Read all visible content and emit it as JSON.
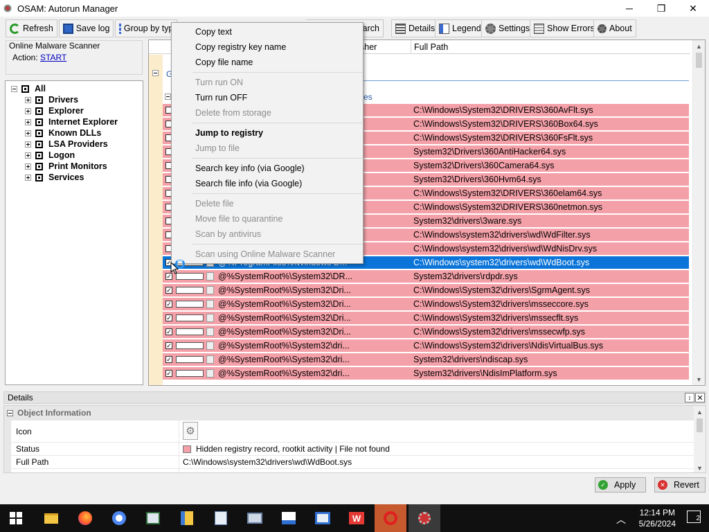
{
  "window": {
    "title": "OSAM: Autorun Manager",
    "minimize": "─",
    "maximize": "❐",
    "close": "✕"
  },
  "toolbar": {
    "refresh": "Refresh",
    "save_log": "Save log",
    "group_by": "Group by typ",
    "search": "earch",
    "details": "Details",
    "legend": "Legend",
    "settings": "Settings",
    "show_errors": "Show Errors",
    "about": "About"
  },
  "scanner": {
    "title": "Online Malware Scanner",
    "action_label": "Action:",
    "action_link": "START"
  },
  "tree": {
    "root": "All",
    "items": [
      "Drivers",
      "Explorer",
      "Internet Explorer",
      "Known DLLs",
      "LSA Providers",
      "Logon",
      "Print Monitors",
      "Services"
    ]
  },
  "list": {
    "columns": {
      "publisher": "sher",
      "full_path": "Full Path"
    },
    "group_label": "G",
    "subgroup_label": "es",
    "rows": [
      {
        "cmd": "",
        "path": "C:\\Windows\\System32\\DRIVERS\\360AvFlt.sys",
        "checked": false
      },
      {
        "cmd": "",
        "path": "C:\\Windows\\System32\\DRIVERS\\360Box64.sys",
        "checked": false
      },
      {
        "cmd": "",
        "path": "C:\\Windows\\System32\\DRIVERS\\360FsFlt.sys",
        "checked": false
      },
      {
        "cmd": "",
        "path": "System32\\Drivers\\360AntiHacker64.sys",
        "checked": false
      },
      {
        "cmd": "",
        "path": "System32\\Drivers\\360Camera64.sys",
        "checked": false
      },
      {
        "cmd": "",
        "path": "System32\\Drivers\\360Hvm64.sys",
        "checked": false
      },
      {
        "cmd": "",
        "path": "C:\\Windows\\System32\\DRIVERS\\360elam64.sys",
        "checked": false
      },
      {
        "cmd": "",
        "path": "C:\\Windows\\System32\\DRIVERS\\360netmon.sys",
        "checked": false
      },
      {
        "cmd": "",
        "path": "System32\\drivers\\3ware.sys",
        "checked": false
      },
      {
        "cmd": "",
        "path": "C:\\Windows\\system32\\drivers\\wd\\WdFilter.sys",
        "checked": false
      },
      {
        "cmd": "",
        "path": "C:\\Windows\\system32\\drivers\\wd\\WdNisDrv.sys",
        "checked": false
      },
      {
        "cmd": "@%ProgramFiles%\\Windows D...",
        "path": "C:\\Windows\\system32\\drivers\\wd\\WdBoot.sys",
        "checked": true,
        "selected": true
      },
      {
        "cmd": "@%SystemRoot%\\System32\\DR...",
        "path": "System32\\drivers\\rdpdr.sys",
        "checked": true
      },
      {
        "cmd": "@%SystemRoot%\\System32\\Dri...",
        "path": "C:\\Windows\\System32\\drivers\\SgrmAgent.sys",
        "checked": true
      },
      {
        "cmd": "@%SystemRoot%\\System32\\Dri...",
        "path": "C:\\Windows\\System32\\drivers\\msseccore.sys",
        "checked": true
      },
      {
        "cmd": "@%SystemRoot%\\System32\\Dri...",
        "path": "C:\\Windows\\System32\\drivers\\mssecflt.sys",
        "checked": true
      },
      {
        "cmd": "@%SystemRoot%\\System32\\Dri...",
        "path": "C:\\Windows\\System32\\drivers\\mssecwfp.sys",
        "checked": true
      },
      {
        "cmd": "@%SystemRoot%\\System32\\dri...",
        "path": "C:\\Windows\\System32\\drivers\\NdisVirtualBus.sys",
        "checked": true
      },
      {
        "cmd": "@%SystemRoot%\\System32\\dri...",
        "path": "System32\\drivers\\ndiscap.sys",
        "checked": true
      },
      {
        "cmd": "@%SystemRoot%\\System32\\dri...",
        "path": "System32\\drivers\\NdisImPlatform.sys",
        "checked": true
      }
    ]
  },
  "context_menu": [
    {
      "label": "Copy text",
      "enabled": true
    },
    {
      "label": "Copy registry key name",
      "enabled": true
    },
    {
      "label": "Copy file name",
      "enabled": true
    },
    {
      "label": "Turn run ON",
      "enabled": false
    },
    {
      "label": "Turn run OFF",
      "enabled": true
    },
    {
      "label": "Delete from storage",
      "enabled": false
    },
    {
      "label": "Jump to registry",
      "enabled": true,
      "bold": true
    },
    {
      "label": "Jump to file",
      "enabled": false
    },
    {
      "label": "Search key info (via Google)",
      "enabled": true
    },
    {
      "label": "Search file info (via Google)",
      "enabled": true
    },
    {
      "label": "Delete file",
      "enabled": false
    },
    {
      "label": "Move file to quarantine",
      "enabled": false
    },
    {
      "label": "Scan by antivirus",
      "enabled": false
    },
    {
      "label": "Scan using Online Malware Scanner",
      "enabled": false
    }
  ],
  "details": {
    "title": "Details",
    "pin": "↕",
    "close": "✕",
    "category": "Object Information",
    "icon_label": "Icon",
    "status_label": "Status",
    "status_value": "Hidden registry record, rootkit activity | File not found",
    "path_label": "Full Path",
    "path_value": "C:\\Windows\\system32\\drivers\\wd\\WdBoot.sys"
  },
  "buttons": {
    "apply": "Apply",
    "revert": "Revert"
  },
  "taskbar": {
    "time": "12:14 PM",
    "date": "5/26/2024",
    "notif_count": "2"
  },
  "colors": {
    "highlight_row": "#f4a0a8",
    "selected_row": "#0a74d8",
    "accent": "#2a9a2a"
  }
}
